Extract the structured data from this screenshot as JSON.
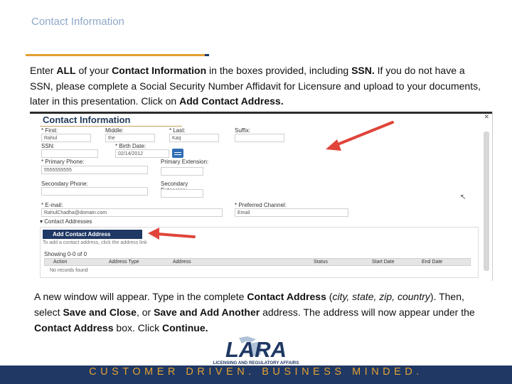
{
  "slide": {
    "title": "Contact Information",
    "intro": {
      "p1": "Enter ",
      "b1": "ALL",
      "p2": " of your ",
      "b2": "Contact Information",
      "p3": " in the boxes provided, including ",
      "b3": "SSN.",
      "p4": "  If you do not have a SSN, please complete a Social Security Number Affidavit for Licensure and upload to your documents, later in  this presentation. Click on ",
      "b4": "Add Contact Address."
    }
  },
  "screenshot": {
    "section_title": "Contact Information",
    "close_glyph": "✕",
    "fields": {
      "first_label": "* First:",
      "first_value": "Rahul",
      "middle_label": "Middle:",
      "middle_value": "the",
      "last_label": "* Last:",
      "last_value": "Kaq",
      "suffix_label": "Suffix:",
      "ssn_label": "SSN:",
      "birth_label": "* Birth Date:",
      "birth_value": "02/14/2012",
      "primary_phone_label": "* Primary Phone:",
      "primary_phone_value": "5555555555",
      "primary_ext_label": "Primary Extension:",
      "secondary_phone_label": "Secondary Phone:",
      "secondary_ext_label": "Secondary Extension:",
      "email_label": "* E-mail:",
      "email_value": "RahulChadha@domain.com",
      "channel_label": "* Preferred Channel:",
      "channel_value": "Email"
    },
    "contact_addresses_label": "▾ Contact Addresses",
    "add_address_button": "Add Contact Address",
    "add_address_hint": "To add a contact address, click the address link",
    "showing": "Showing 0-0 of 0",
    "table_headers": [
      "Action",
      "Address Type",
      "Address",
      "Status",
      "Start Date",
      "End Date"
    ],
    "no_records": "No records found",
    "cursor_glyph": "↖"
  },
  "instructions": {
    "p1": "A new window will appear.  Type in the complete ",
    "b1": "Contact Address",
    "p2": " (",
    "i1": "city, state, zip, country",
    "p3": ").  Then, select ",
    "b2": "Save and Close",
    "p4": ", or ",
    "b3": "Save and Add Another",
    "p5": " address.  The address will now appear under the ",
    "b4": "Contact Address",
    "p6": " box.  Click ",
    "b5": "Continue."
  },
  "logo": {
    "wordmark": "LARA",
    "tagline": "LICENSING AND REGULATORY AFFAIRS"
  },
  "footer": {
    "text": "CUSTOMER DRIVEN. BUSINESS MINDED."
  },
  "colors": {
    "navy": "#1f3864",
    "gold": "#e3a033",
    "title_blue": "#8fa8c8",
    "arrow_red": "#e0443a"
  }
}
